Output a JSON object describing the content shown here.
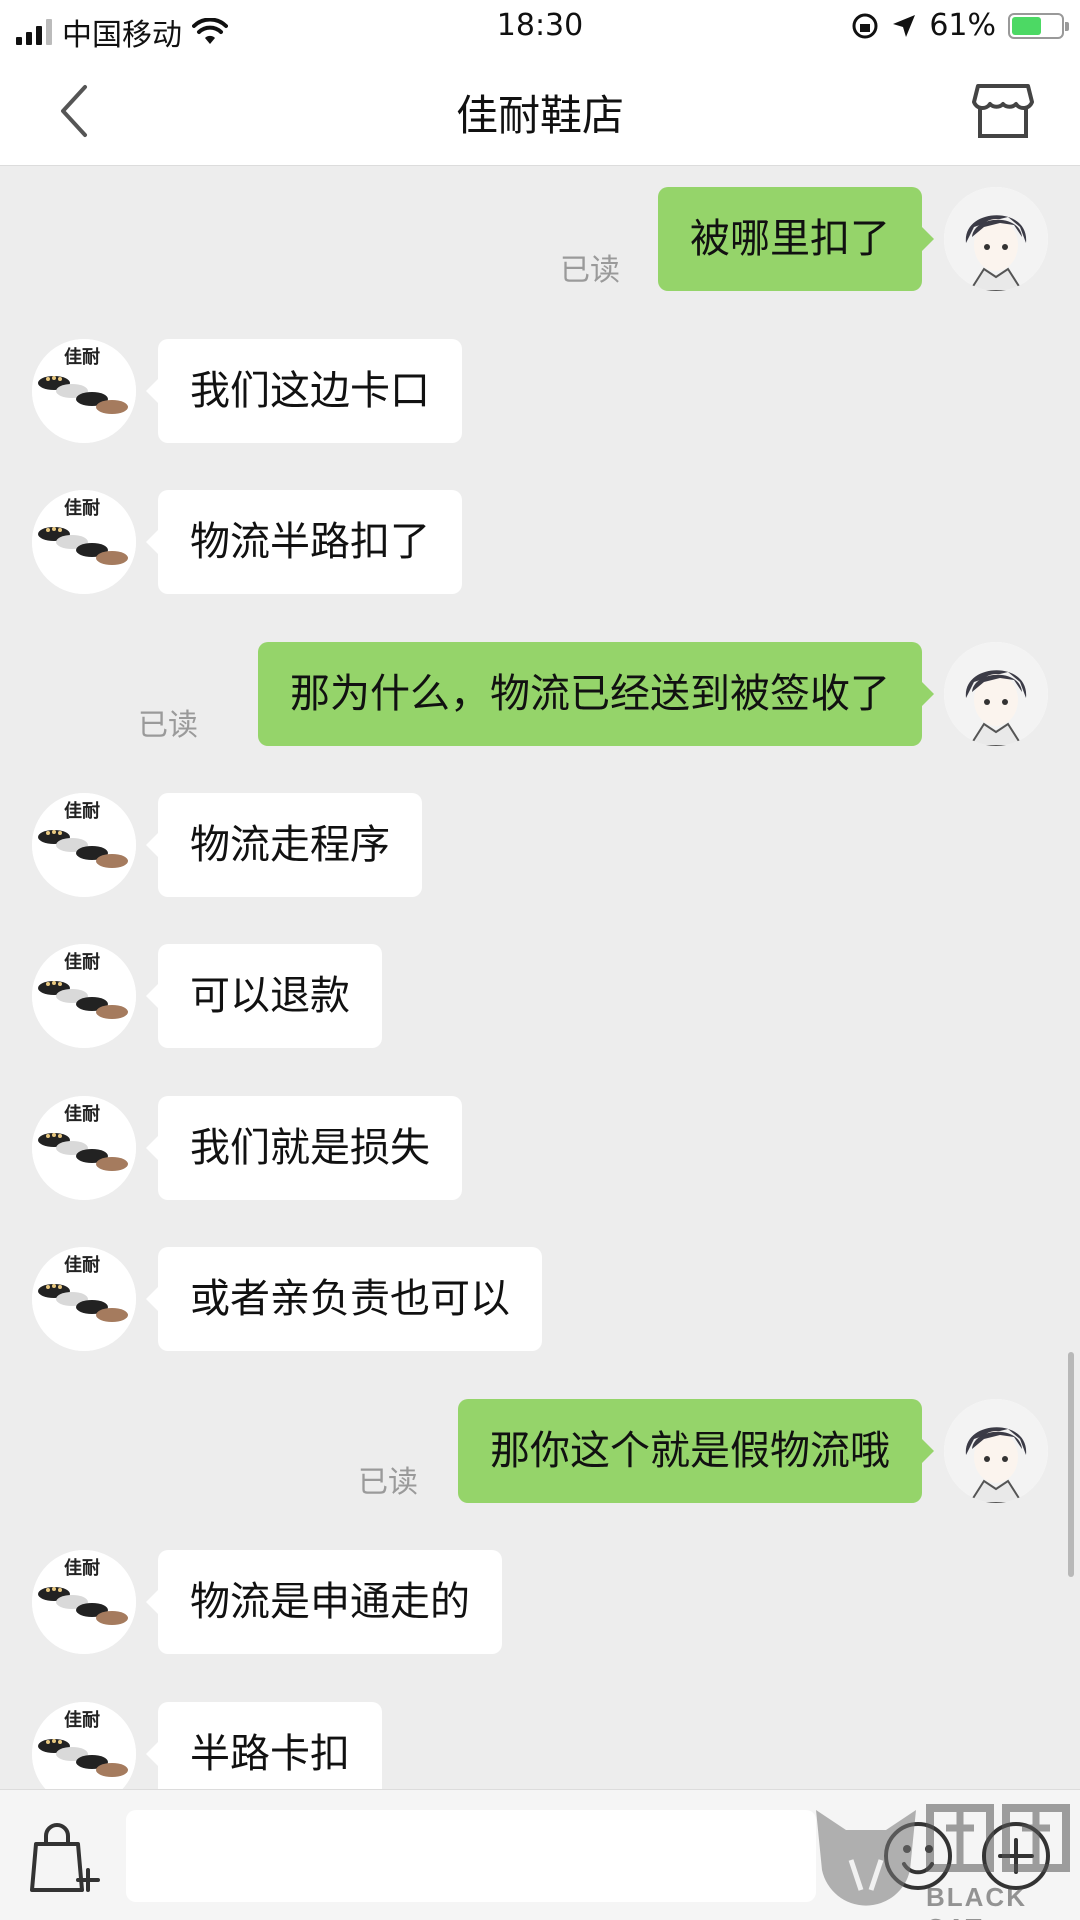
{
  "status_bar": {
    "carrier": "中国移动",
    "time": "18:30",
    "battery": "61%"
  },
  "nav": {
    "title": "佳耐鞋店"
  },
  "messages": [
    {
      "side": "right",
      "text": "被哪里扣了",
      "read": "已读"
    },
    {
      "side": "left",
      "text": "我们这边卡口",
      "avatar_text": "佳耐"
    },
    {
      "side": "left",
      "text": "物流半路扣了",
      "avatar_text": "佳耐"
    },
    {
      "side": "right",
      "text": "那为什么，物流已经送到被签收了",
      "read": "已读"
    },
    {
      "side": "left",
      "text": "物流走程序",
      "avatar_text": "佳耐"
    },
    {
      "side": "left",
      "text": "可以退款",
      "avatar_text": "佳耐"
    },
    {
      "side": "left",
      "text": "我们就是损失",
      "avatar_text": "佳耐"
    },
    {
      "side": "left",
      "text": "或者亲负责也可以",
      "avatar_text": "佳耐"
    },
    {
      "side": "right",
      "text": "那你这个就是假物流哦",
      "read": "已读"
    },
    {
      "side": "left",
      "text": "物流是申通走的",
      "avatar_text": "佳耐"
    },
    {
      "side": "left",
      "text": "半路卡扣",
      "avatar_text": "佳耐"
    }
  ],
  "input": {
    "placeholder": ""
  },
  "watermark": {
    "text": "BLACK CAT",
    "glyphs": "黑猫"
  },
  "colors": {
    "sent_bubble": "#95d46a",
    "received_bubble": "#ffffff",
    "background": "#ededed"
  }
}
